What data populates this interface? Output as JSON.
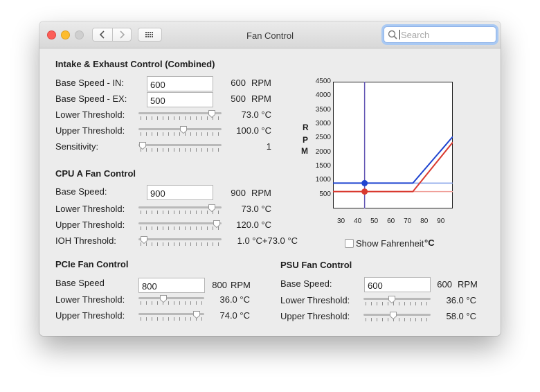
{
  "window": {
    "title": "Fan Control",
    "search_placeholder": "Search"
  },
  "combined": {
    "title": "Intake & Exhaust Control (Combined)",
    "base_in": {
      "label": "Base Speed - IN:",
      "field": "600",
      "value": "600",
      "unit": "RPM"
    },
    "base_ex": {
      "label": "Base Speed - EX:",
      "field": "500",
      "value": "500",
      "unit": "RPM"
    },
    "lower": {
      "label": "Lower Threshold:",
      "value": "73.0 °C",
      "level": 0.93
    },
    "upper": {
      "label": "Upper Threshold:",
      "value": "100.0 °C",
      "level": 0.55
    },
    "sensitivity": {
      "label": "Sensitivity:",
      "value": "1",
      "level": 0.0
    }
  },
  "cpu": {
    "title": "CPU A Fan Control",
    "base": {
      "label": "Base Speed:",
      "field": "900",
      "value": "900",
      "unit": "RPM"
    },
    "lower": {
      "label": "Lower Threshold:",
      "value": "73.0 °C",
      "level": 0.93
    },
    "upper": {
      "label": "Upper Threshold:",
      "value": "120.0 °C",
      "level": 0.99
    },
    "ioh": {
      "label": "IOH Threshold:",
      "value": "1.0 °C+73.0 °C",
      "level": 0.02
    }
  },
  "pcie": {
    "title": "PCIe Fan Control",
    "base": {
      "label": "Base Speed",
      "field": "800",
      "value": "800",
      "unit": "RPM"
    },
    "lower": {
      "label": "Lower Threshold:",
      "value": "36.0 °C",
      "level": 0.36
    },
    "upper": {
      "label": "Upper Threshold:",
      "value": "74.0 °C",
      "level": 0.94
    }
  },
  "psu": {
    "title": "PSU Fan Control",
    "base": {
      "label": "Base Speed:",
      "field": "600",
      "value": "600",
      "unit": "RPM"
    },
    "lower": {
      "label": "Lower Threshold:",
      "value": "36.0 °C",
      "level": 0.41
    },
    "upper": {
      "label": "Upper Threshold:",
      "value": "58.0 °C",
      "level": 0.44
    }
  },
  "show_fahrenheit": {
    "label": "Show Fahrenheit",
    "checked": false,
    "unit": "°C"
  },
  "chart_data": {
    "type": "line",
    "ylabel": [
      "R",
      "P",
      "M"
    ],
    "y_ticks": [
      "4500",
      "4000",
      "3500",
      "3000",
      "2500",
      "2000",
      "1500",
      "1000",
      "500"
    ],
    "x_ticks": [
      "30",
      "40",
      "50",
      "60",
      "70",
      "80",
      "90"
    ],
    "xlim": [
      25,
      97
    ],
    "ylim": [
      0,
      4500
    ],
    "current_temp": 44,
    "series": [
      {
        "color": "#1f44d0",
        "light_color": "#7f9ee8",
        "x": [
          25,
          73,
          97
        ],
        "y": [
          900,
          900,
          2550
        ],
        "marker": [
          44,
          900
        ]
      },
      {
        "color": "#d93a30",
        "light_color": "#f0a09a",
        "x": [
          25,
          73,
          97
        ],
        "y": [
          600,
          600,
          2350
        ],
        "marker": [
          44,
          600
        ]
      }
    ]
  }
}
